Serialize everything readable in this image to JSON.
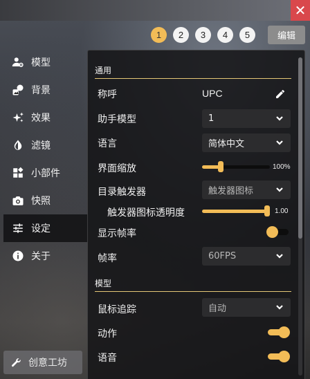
{
  "page_tabs": [
    "1",
    "2",
    "3",
    "4",
    "5"
  ],
  "active_tab": "1",
  "edit_label": "编辑",
  "close_glyph": "✕",
  "sidebar": {
    "items": [
      {
        "label": "模型",
        "icon": "user-settings-icon"
      },
      {
        "label": "背景",
        "icon": "image-icon"
      },
      {
        "label": "效果",
        "icon": "sparkle-icon"
      },
      {
        "label": "滤镜",
        "icon": "contrast-icon"
      },
      {
        "label": "小部件",
        "icon": "widgets-icon"
      },
      {
        "label": "快照",
        "icon": "camera-icon"
      },
      {
        "label": "设定",
        "icon": "sliders-icon",
        "active": true
      },
      {
        "label": "关于",
        "icon": "info-icon"
      }
    ],
    "workshop_label": "创意工坊"
  },
  "settings": {
    "general_title": "通用",
    "nickname_label": "称呼",
    "nickname_value": "UPC",
    "assistant_model_label": "助手模型",
    "assistant_model_value": "1",
    "language_label": "语言",
    "language_value": "简体中文",
    "ui_scale_label": "界面缩放",
    "ui_scale_value": "100%",
    "ui_scale_level": 0.25,
    "menu_trigger_label": "目录触发器",
    "menu_trigger_value": "触发器图标",
    "trigger_opacity_label": "触发器图标透明度",
    "trigger_opacity_value": "1.00",
    "trigger_opacity_level": 1.0,
    "show_fps_label": "显示帧率",
    "show_fps_on": false,
    "fps_label": "帧率",
    "fps_value": "60FPS",
    "model_title": "模型",
    "mouse_tracking_label": "鼠标追踪",
    "mouse_tracking_value": "自动",
    "motion_label": "动作",
    "motion_on": true,
    "voice_label": "语音",
    "voice_on": true
  },
  "colors": {
    "accent": "#f2bc57",
    "close": "#d9484c",
    "panel": "#161618"
  }
}
